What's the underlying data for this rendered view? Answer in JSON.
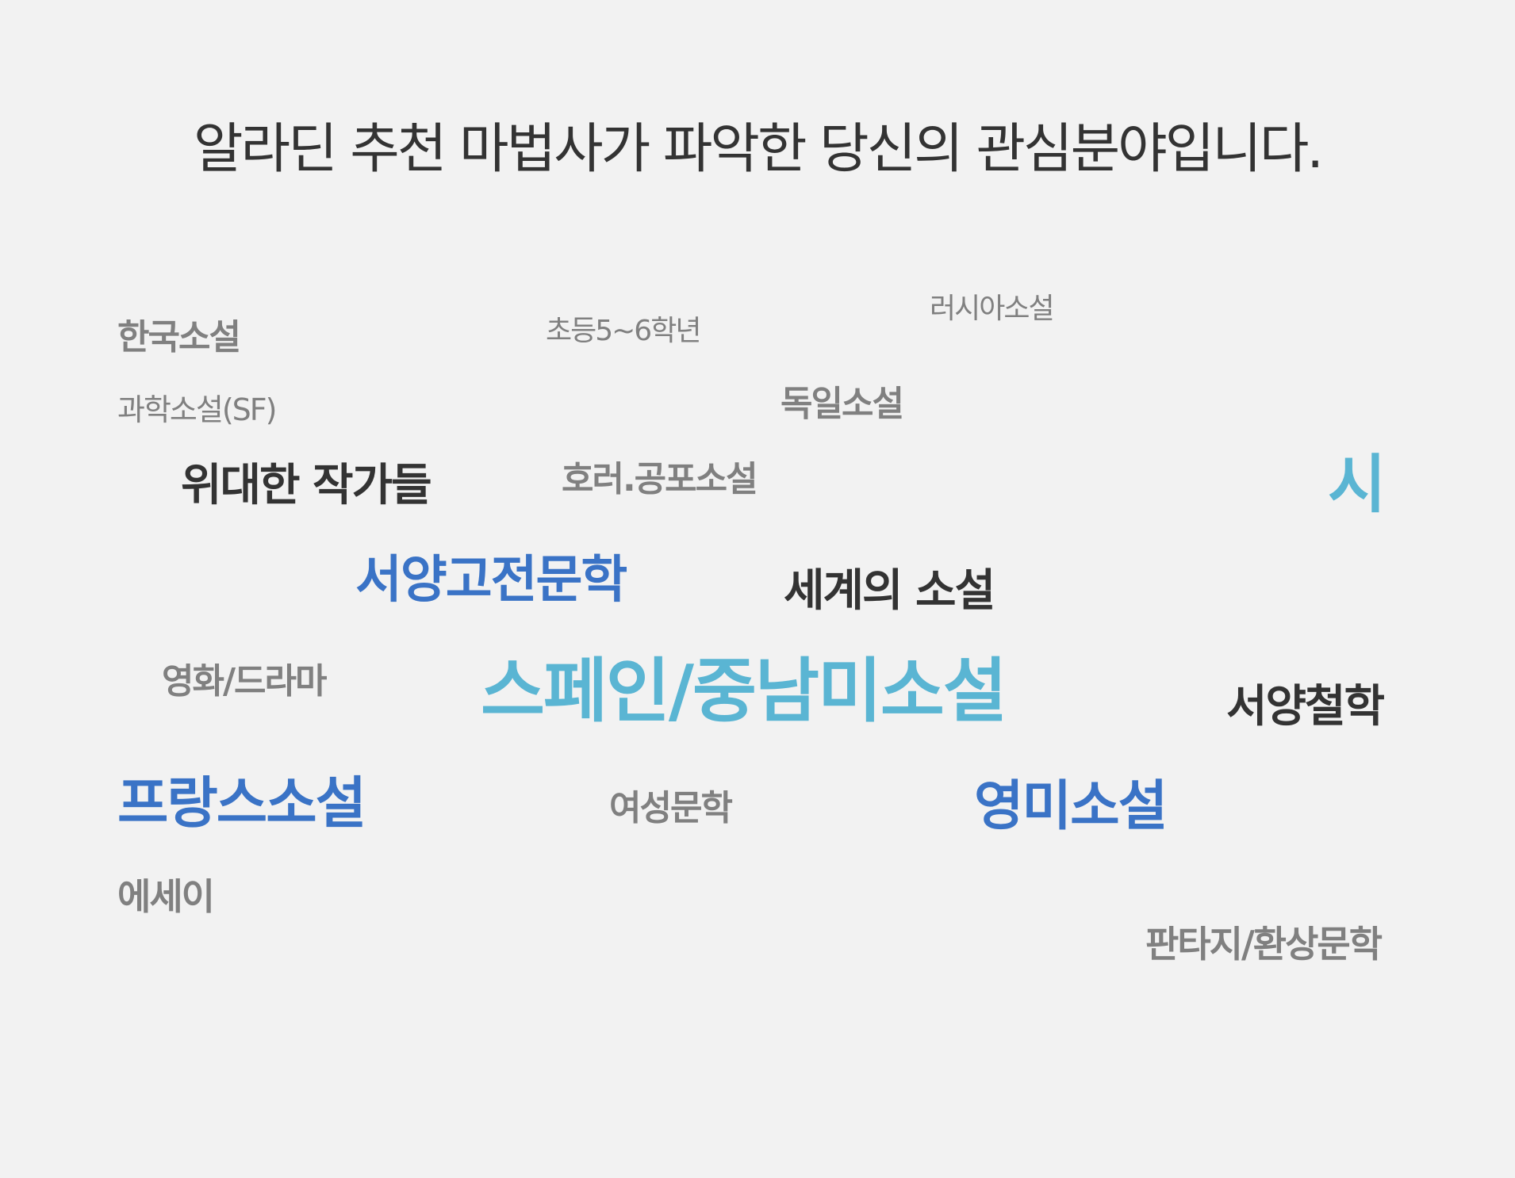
{
  "headline": "알라딘 추천 마법사가 파악한 당신의 관심분야입니다.",
  "tags": [
    {
      "label": "한국소설",
      "color": "#808080",
      "weight": "bold"
    },
    {
      "label": "초등5~6학년",
      "color": "#808080",
      "weight": "regular"
    },
    {
      "label": "러시아소설",
      "color": "#808080",
      "weight": "regular"
    },
    {
      "label": "과학소설(SF)",
      "color": "#808080",
      "weight": "regular"
    },
    {
      "label": "독일소설",
      "color": "#808080",
      "weight": "bold"
    },
    {
      "label": "위대한 작가들",
      "color": "#333333",
      "weight": "bold"
    },
    {
      "label": "호러.공포소설",
      "color": "#808080",
      "weight": "bold"
    },
    {
      "label": "시",
      "color": "#5ab5d3",
      "weight": "bold"
    },
    {
      "label": "서양고전문학",
      "color": "#3a73c6",
      "weight": "bold"
    },
    {
      "label": "세계의 소설",
      "color": "#333333",
      "weight": "bold"
    },
    {
      "label": "영화/드라마",
      "color": "#808080",
      "weight": "bold"
    },
    {
      "label": "스페인/중남미소설",
      "color": "#5ab5d3",
      "weight": "bold"
    },
    {
      "label": "서양철학",
      "color": "#333333",
      "weight": "bold"
    },
    {
      "label": "프랑스소설",
      "color": "#3a73c6",
      "weight": "bold"
    },
    {
      "label": "여성문학",
      "color": "#808080",
      "weight": "bold"
    },
    {
      "label": "영미소설",
      "color": "#3a73c6",
      "weight": "bold"
    },
    {
      "label": "에세이",
      "color": "#808080",
      "weight": "bold"
    },
    {
      "label": "판타지/환상문학",
      "color": "#808080",
      "weight": "bold"
    }
  ]
}
